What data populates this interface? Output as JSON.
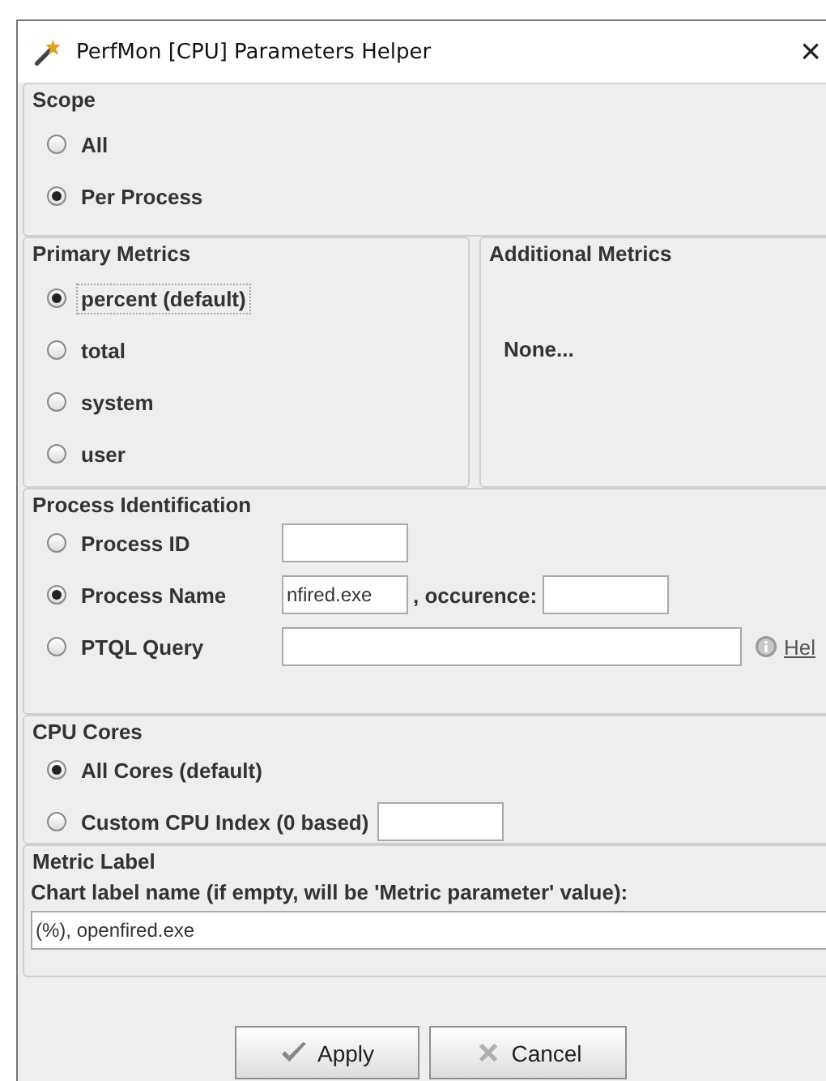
{
  "window": {
    "title": "PerfMon [CPU] Parameters Helper",
    "close": "×"
  },
  "scope": {
    "title": "Scope",
    "options": [
      {
        "label": "All",
        "selected": false
      },
      {
        "label": "Per Process",
        "selected": true
      }
    ]
  },
  "primary_metrics": {
    "title": "Primary Metrics",
    "options": [
      {
        "label": "percent (default)",
        "selected": true,
        "focused": true
      },
      {
        "label": "total",
        "selected": false,
        "focused": false
      },
      {
        "label": "system",
        "selected": false,
        "focused": false
      },
      {
        "label": "user",
        "selected": false,
        "focused": false
      }
    ]
  },
  "additional_metrics": {
    "title": "Additional Metrics",
    "text": "None..."
  },
  "process_identification": {
    "title": "Process Identification",
    "rows": [
      {
        "label": "Process ID",
        "selected": false,
        "extras": [
          {
            "kind": "field"
          }
        ]
      },
      {
        "label": "Process Name",
        "selected": true,
        "extras": [
          {
            "kind": "field",
            "value": "nfired.exe"
          },
          {
            "kind": "text",
            "text": ", occurence:"
          },
          {
            "kind": "field"
          }
        ]
      },
      {
        "label": "PTQL Query",
        "selected": false,
        "extras": [
          {
            "kind": "wide-field"
          },
          {
            "kind": "help",
            "text": "Hel"
          }
        ]
      }
    ]
  },
  "cpu_cores": {
    "title": "CPU Cores",
    "rows": [
      {
        "label": "All Cores (default)",
        "selected": true,
        "extras": []
      },
      {
        "label": "Custom CPU Index (0 based)",
        "selected": false,
        "extras": [
          {
            "kind": "field"
          }
        ]
      }
    ]
  },
  "metric_label": {
    "title": "Metric Label",
    "prompt": "Chart label name (if empty, will be 'Metric parameter' value):",
    "value": "(%), openfired.exe"
  },
  "buttons": [
    {
      "kind": "apply",
      "label": "Apply"
    },
    {
      "kind": "cancel",
      "label": "Cancel"
    }
  ]
}
